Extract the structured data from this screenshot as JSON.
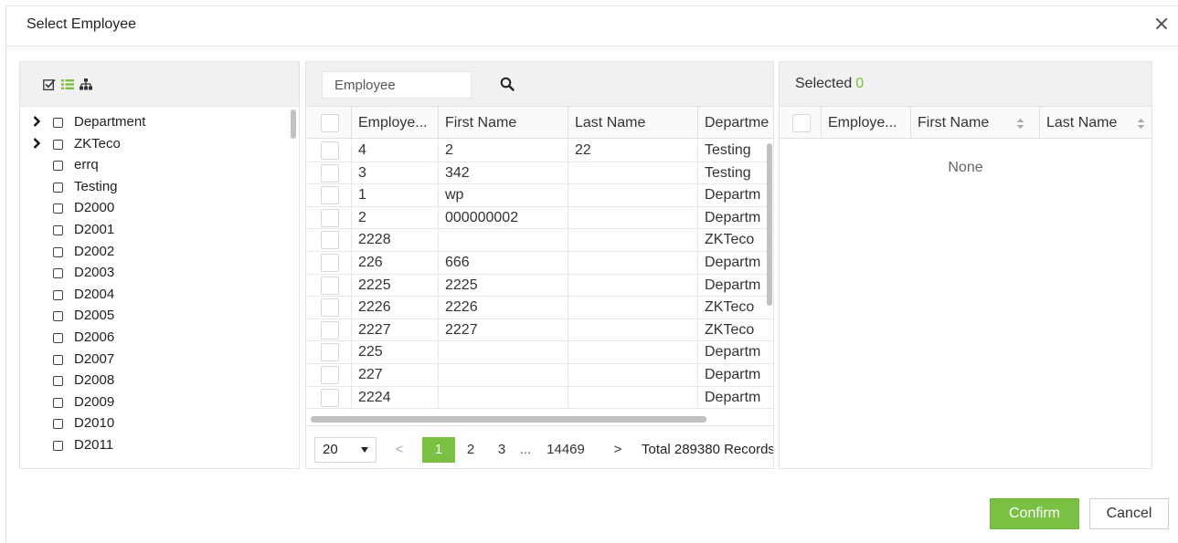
{
  "dialog": {
    "title": "Select Employee",
    "close_icon": "close-icon"
  },
  "tree": {
    "toolbar_icons": [
      "check-all-icon",
      "list-icon",
      "org-chart-icon"
    ],
    "items": [
      {
        "label": "Department",
        "expandable": true
      },
      {
        "label": "ZKTeco",
        "expandable": true
      },
      {
        "label": "errq",
        "expandable": false
      },
      {
        "label": "Testing",
        "expandable": false
      },
      {
        "label": "D2000",
        "expandable": false
      },
      {
        "label": "D2001",
        "expandable": false
      },
      {
        "label": "D2002",
        "expandable": false
      },
      {
        "label": "D2003",
        "expandable": false
      },
      {
        "label": "D2004",
        "expandable": false
      },
      {
        "label": "D2005",
        "expandable": false
      },
      {
        "label": "D2006",
        "expandable": false
      },
      {
        "label": "D2007",
        "expandable": false
      },
      {
        "label": "D2008",
        "expandable": false
      },
      {
        "label": "D2009",
        "expandable": false
      },
      {
        "label": "D2010",
        "expandable": false
      },
      {
        "label": "D2011",
        "expandable": false
      }
    ]
  },
  "employees": {
    "search_placeholder": "Employee",
    "search_icon": "search-icon",
    "columns": [
      "Employe...",
      "First Name",
      "Last Name",
      "Departme"
    ],
    "rows": [
      {
        "id": "4",
        "first": "2",
        "last": "22",
        "dept": "Testing"
      },
      {
        "id": "3",
        "first": "342",
        "last": "",
        "dept": "Testing"
      },
      {
        "id": "1",
        "first": "wp",
        "last": "",
        "dept": "Departm"
      },
      {
        "id": "2",
        "first": "000000002",
        "last": "",
        "dept": "Departm"
      },
      {
        "id": "2228",
        "first": "",
        "last": "",
        "dept": "ZKTeco"
      },
      {
        "id": "226",
        "first": "666",
        "last": "",
        "dept": "Departm"
      },
      {
        "id": "2225",
        "first": "2225",
        "last": "",
        "dept": "Departm"
      },
      {
        "id": "2226",
        "first": "2226",
        "last": "",
        "dept": "ZKTeco"
      },
      {
        "id": "2227",
        "first": "2227",
        "last": "",
        "dept": "ZKTeco"
      },
      {
        "id": "225",
        "first": "",
        "last": "",
        "dept": "Departm"
      },
      {
        "id": "227",
        "first": "",
        "last": "",
        "dept": "Departm"
      },
      {
        "id": "2224",
        "first": "",
        "last": "",
        "dept": "Departm"
      }
    ],
    "pager": {
      "page_size": "20",
      "prev": "<",
      "current": "1",
      "page2": "2",
      "page3": "3",
      "ellipsis": "...",
      "last": "14469",
      "next": ">",
      "total": "Total 289380 Records"
    }
  },
  "selected": {
    "label": "Selected",
    "count": "0",
    "columns": [
      "Employe...",
      "First Name",
      "Last Name"
    ],
    "empty_text": "None"
  },
  "footer": {
    "confirm_label": "Confirm",
    "cancel_label": "Cancel"
  },
  "colors": {
    "accent": "#7ac143",
    "toolbar_bg": "#f1f1f1",
    "border": "#e3e3e3"
  }
}
